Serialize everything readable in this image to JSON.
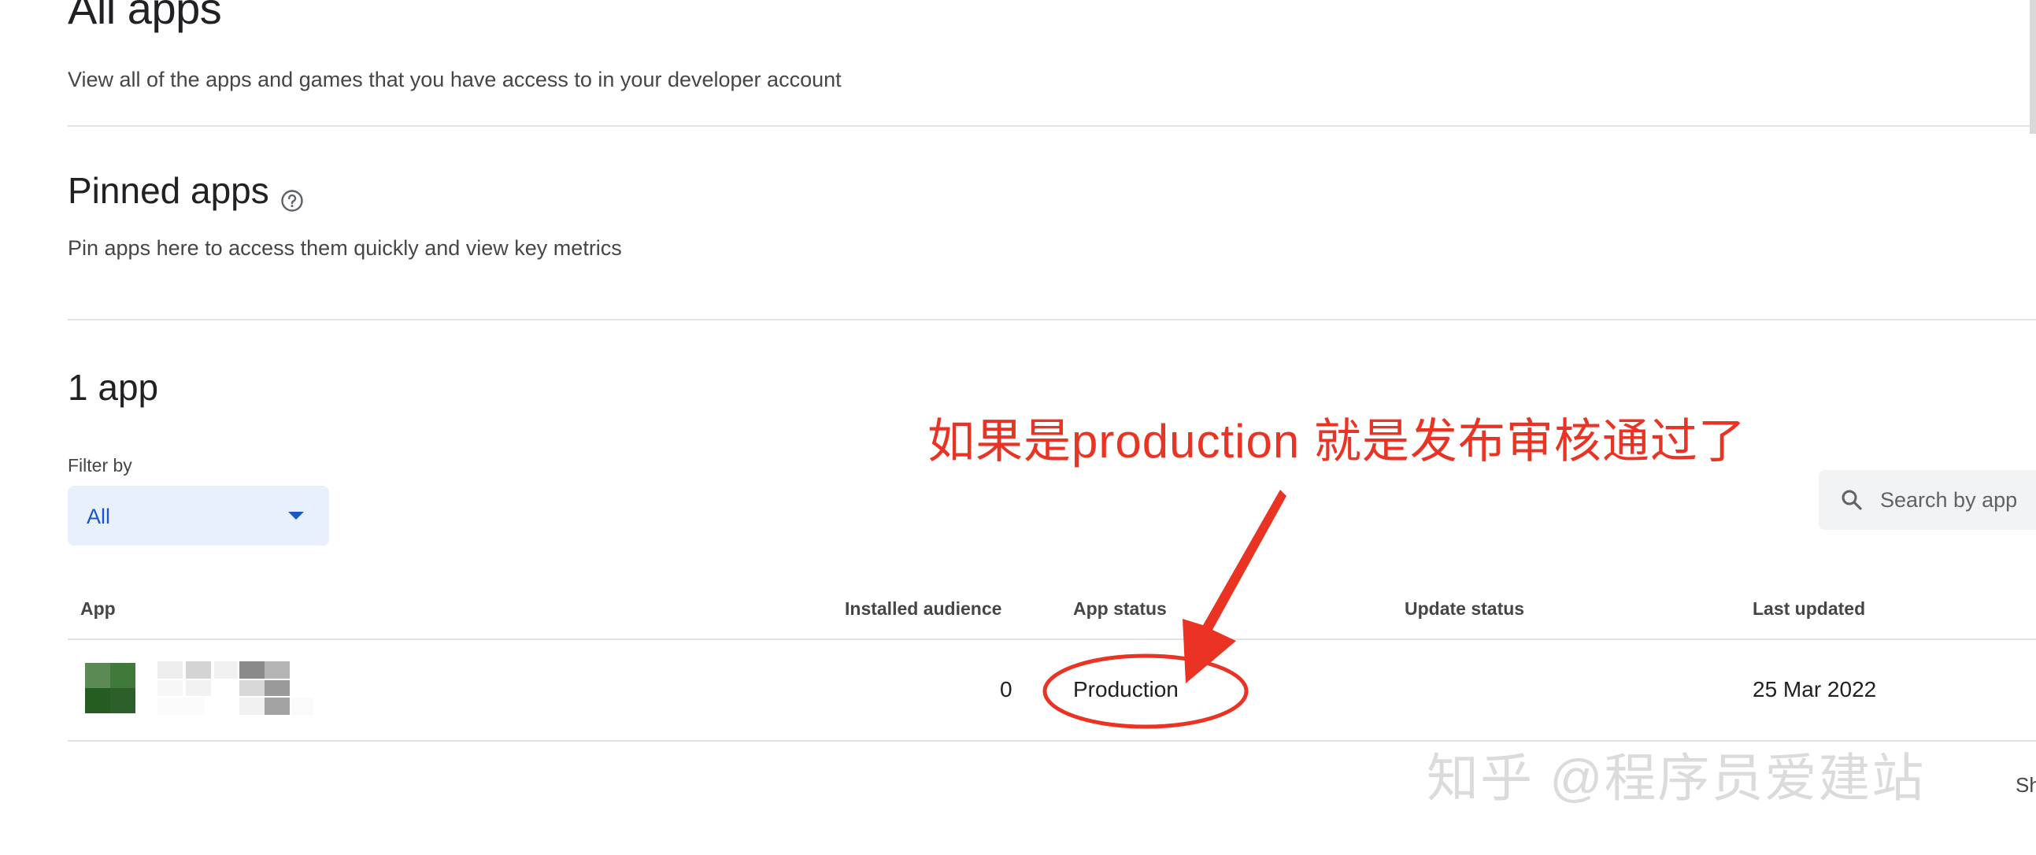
{
  "page": {
    "title": "All apps",
    "subtitle": "View all of the apps and games that you have access to in your developer account"
  },
  "pinned": {
    "title": "Pinned apps",
    "help_icon": "help-circle-icon",
    "subtitle": "Pin apps here to access them quickly and view key metrics"
  },
  "apps": {
    "count_title": "1 app",
    "filter": {
      "label": "Filter by",
      "selected": "All"
    },
    "search": {
      "icon": "search-icon",
      "placeholder": "Search by app"
    },
    "columns": [
      "App",
      "Installed audience",
      "App status",
      "Update status",
      "Last updated"
    ],
    "rows": [
      {
        "app_name": "",
        "installed_audience": "0",
        "app_status": "Production",
        "update_status": "",
        "last_updated": "25 Mar 2022"
      }
    ],
    "footer_fragment": "Sh"
  },
  "annotation": {
    "text": "如果是production 就是发布审核通过了",
    "color": "#ea3323"
  },
  "watermark": {
    "text": "知乎 @程序员爱建站"
  },
  "colors": {
    "accent": "#1a56c9",
    "filter_bg": "#e8f0fe",
    "annotation_red": "#ea3323"
  }
}
